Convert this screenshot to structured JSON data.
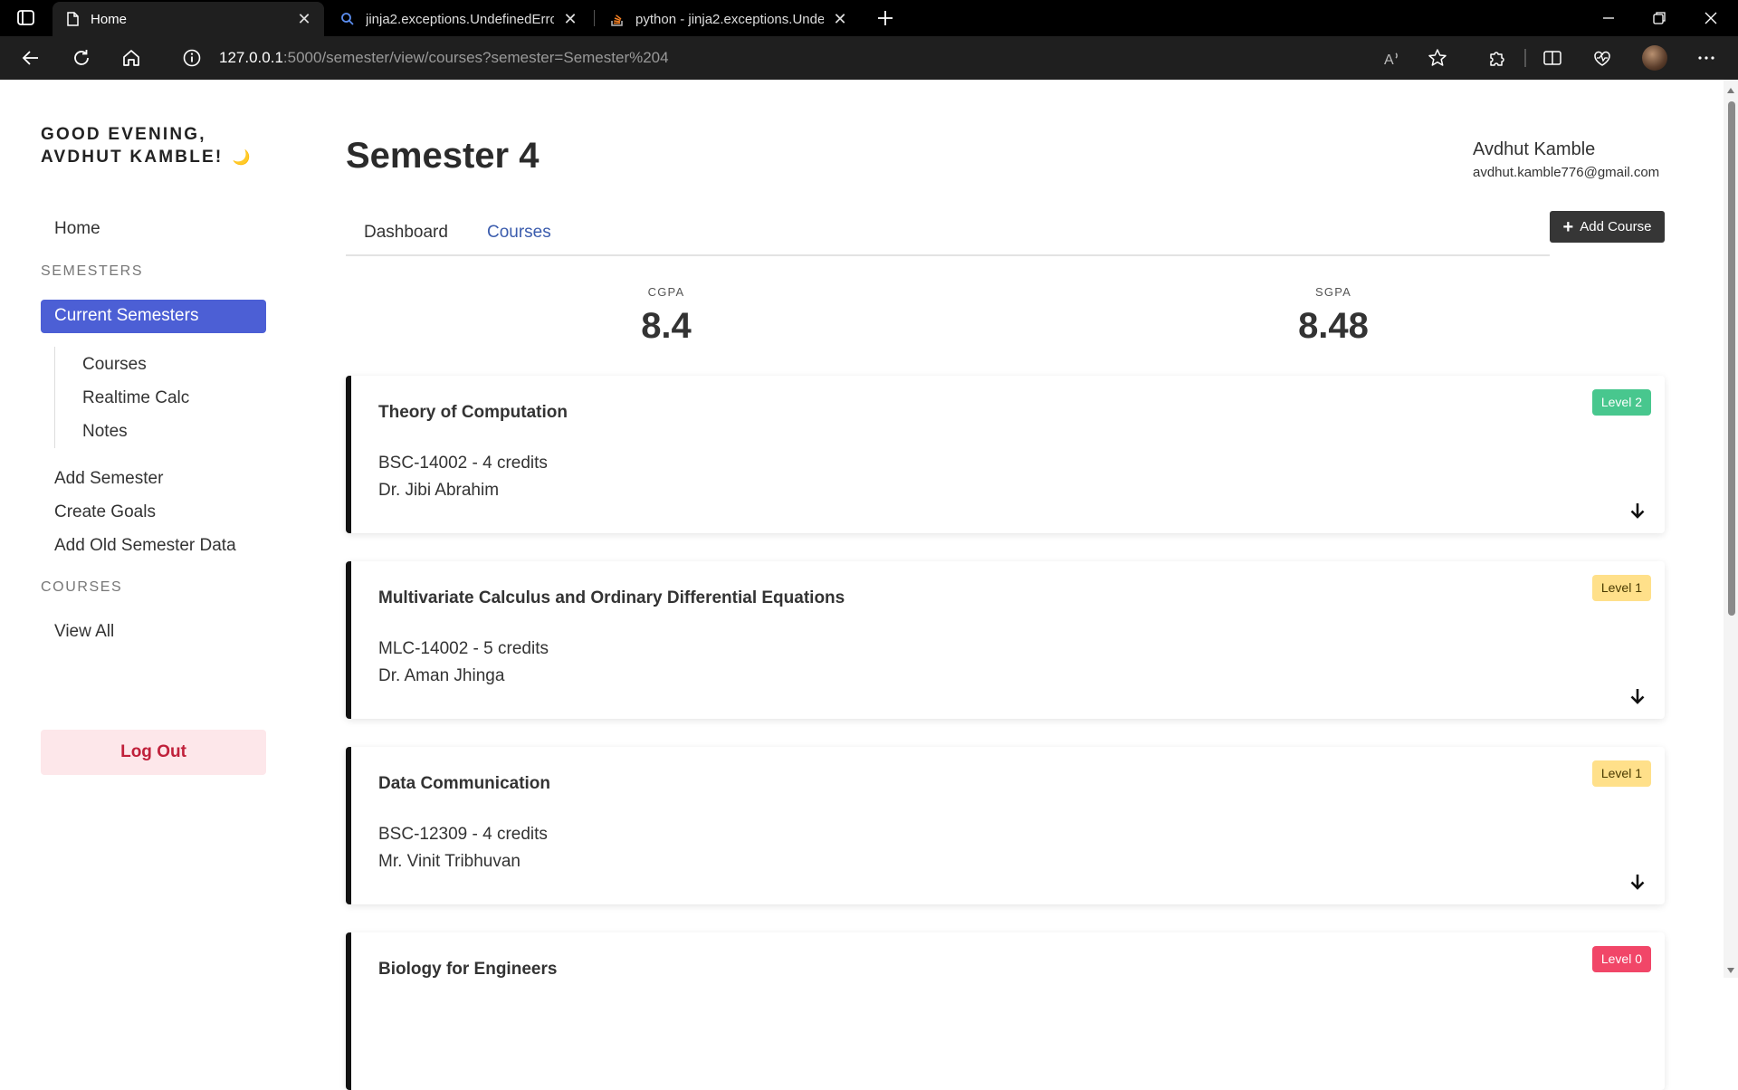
{
  "browser": {
    "tabs": [
      {
        "title": "Home",
        "icon": "page-icon",
        "active": true
      },
      {
        "title": "jinja2.exceptions.UndefinedError:",
        "icon": "search-icon",
        "active": false
      },
      {
        "title": "python - jinja2.exceptions.Undefi",
        "icon": "stackoverflow-icon",
        "active": false
      }
    ],
    "url": {
      "host": "127.0.0.1",
      "path": ":5000/semester/view/courses?semester=Semester%204"
    }
  },
  "sidebar": {
    "greeting_line1": "GOOD EVENING,",
    "greeting_line2": "AVDHUT KAMBLE!",
    "home": "Home",
    "semesters_heading": "SEMESTERS",
    "current_semesters": "Current Semesters",
    "sub_items": [
      "Courses",
      "Realtime Calc",
      "Notes"
    ],
    "add_semester": "Add Semester",
    "create_goals": "Create Goals",
    "add_old_semester": "Add Old Semester Data",
    "courses_heading": "COURSES",
    "view_all": "View All",
    "logout": "Log Out"
  },
  "main": {
    "title": "Semester 4",
    "user": {
      "name": "Avdhut Kamble",
      "email": "avdhut.kamble776@gmail.com"
    },
    "add_course_label": "Add Course",
    "tabs": {
      "dashboard": "Dashboard",
      "courses": "Courses"
    },
    "stats": {
      "cgpa_label": "CGPA",
      "cgpa_value": "8.4",
      "sgpa_label": "SGPA",
      "sgpa_value": "8.48"
    },
    "courses": [
      {
        "name": "Theory of Computation",
        "code": "BSC-14002 - 4 credits",
        "professor": "Dr. Jibi Abrahim",
        "level": "Level 2",
        "level_color": "#48c78e"
      },
      {
        "name": "Multivariate Calculus and Ordinary Differential Equations",
        "code": "MLC-14002 - 5 credits",
        "professor": "Dr. Aman Jhinga",
        "level": "Level 1",
        "level_color": "#ffe08a"
      },
      {
        "name": "Data Communication",
        "code": "BSC-12309 - 4 credits",
        "professor": "Mr. Vinit Tribhuvan",
        "level": "Level 1",
        "level_color": "#ffe08a"
      },
      {
        "name": "Biology for Engineers",
        "level": "Level 0",
        "level_color": "#f14668"
      }
    ]
  }
}
